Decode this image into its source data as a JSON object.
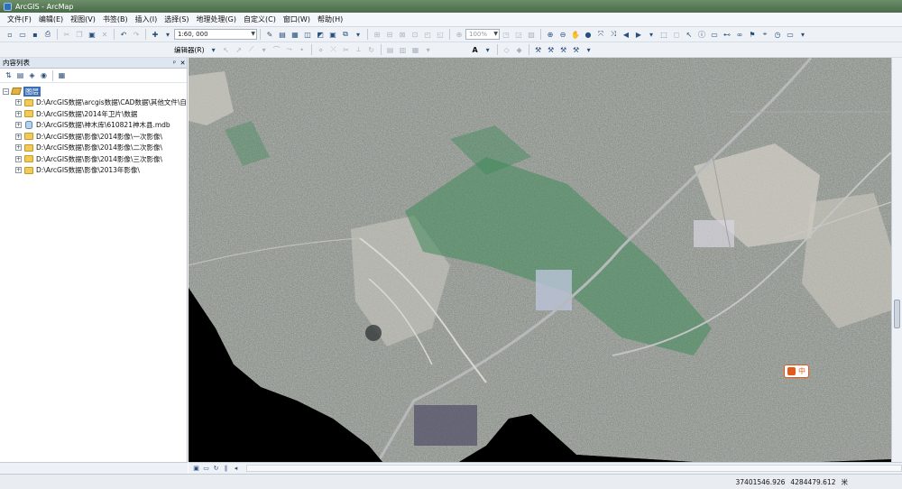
{
  "window": {
    "title": "ArcGIS - ArcMap"
  },
  "menu": [
    "文件(F)",
    "编辑(E)",
    "视图(V)",
    "书签(B)",
    "插入(I)",
    "选择(S)",
    "地理处理(G)",
    "自定义(C)",
    "窗口(W)",
    "帮助(H)"
  ],
  "toolbar": {
    "scale_value": "1:60, 000",
    "zoom_percent": "100%",
    "editor_label": "编辑器(R)",
    "text_tool": "A"
  },
  "toc": {
    "title": "内容列表",
    "pin_glyph": "ᵖ",
    "close_glyph": "✕",
    "layers_label": "图层",
    "items": [
      {
        "label": "D:\\ArcGIS数据\\arcgis数据\\CAD数据\\其他文件\\自",
        "type": "folder"
      },
      {
        "label": "D:\\ArcGIS数据\\2014年卫片\\数据",
        "type": "folder"
      },
      {
        "label": "D:\\ArcGIS数据\\神木库\\610821神木县.mdb",
        "type": "database"
      },
      {
        "label": "D:\\ArcGIS数据\\影像\\2014影像\\一次影像\\",
        "type": "folder"
      },
      {
        "label": "D:\\ArcGIS数据\\影像\\2014影像\\二次影像\\",
        "type": "folder"
      },
      {
        "label": "D:\\ArcGIS数据\\影像\\2014影像\\三次影像\\",
        "type": "folder"
      },
      {
        "label": "D:\\ArcGIS数据\\影像\\2013年影像\\",
        "type": "folder"
      }
    ]
  },
  "map": {
    "ime_indicator": "中"
  },
  "status": {
    "x": "37401546.926",
    "y": "4284479.612",
    "unit": "米"
  },
  "colors": {
    "selection": "#3a6fb5",
    "titlebar": "#4a6b4a"
  }
}
